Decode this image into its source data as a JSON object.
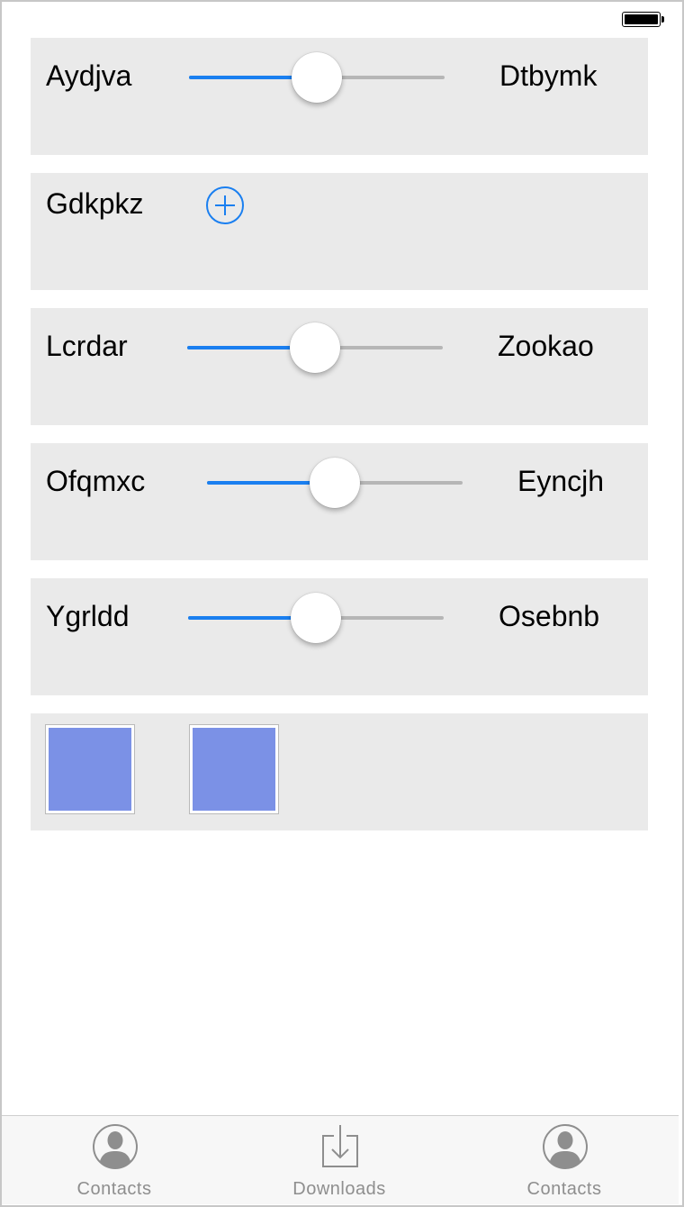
{
  "colors": {
    "accent": "#1a7ff0",
    "row_bg": "#eaeaea",
    "swatch": "#7b91e6",
    "tab_gray": "#8e8e8e"
  },
  "rows": [
    {
      "type": "slider",
      "left_label": "Aydjva",
      "right_label": "Dtbymk",
      "value": 0.5
    },
    {
      "type": "add",
      "label": "Gdkpkz",
      "icon": "plus-circle-icon"
    },
    {
      "type": "slider",
      "left_label": "Lcrdar",
      "right_label": "Zookao",
      "value": 0.5
    },
    {
      "type": "slider",
      "left_label": "Ofqmxc",
      "right_label": "Eyncjh",
      "value": 0.5
    },
    {
      "type": "slider",
      "left_label": "Ygrldd",
      "right_label": "Osebnb",
      "value": 0.5
    },
    {
      "type": "swatches",
      "swatches": [
        "#7b91e6",
        "#7b91e6"
      ]
    }
  ],
  "tabs": [
    {
      "label": "Contacts",
      "icon": "contact-icon"
    },
    {
      "label": "Downloads",
      "icon": "download-icon"
    },
    {
      "label": "Contacts",
      "icon": "contact-icon"
    }
  ]
}
